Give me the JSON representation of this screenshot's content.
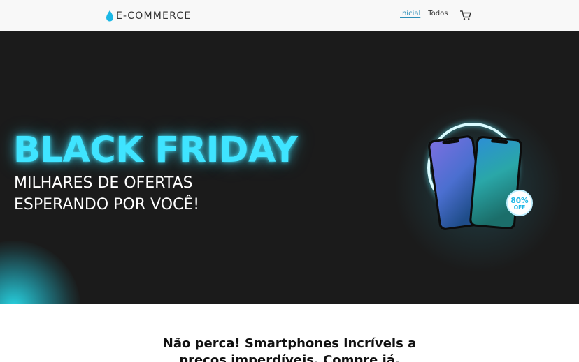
{
  "navbar": {
    "brand": "E-COMMERCE",
    "brand_icon": "water-drop-icon",
    "links": [
      {
        "label": "Inicial",
        "active": true
      },
      {
        "label": "Todos",
        "active": false
      }
    ],
    "cart_icon": "shopping-cart-icon"
  },
  "hero": {
    "title": "BLACK FRIDAY",
    "subtitle_line1": "MILHARES DE OFERTAS",
    "subtitle_line2": "ESPERANDO POR VOCÊ!",
    "badge_line1": "80%",
    "badge_line2": "OFF",
    "illustration": "smartphones-illustration"
  },
  "content": {
    "tagline": "Não perca! Smartphones incríveis a preços imperdíveis. Compre já."
  },
  "colors": {
    "accent": "#3fe4ff",
    "hero_bg": "#1b1b1b",
    "link_active": "#2d8fb8"
  }
}
